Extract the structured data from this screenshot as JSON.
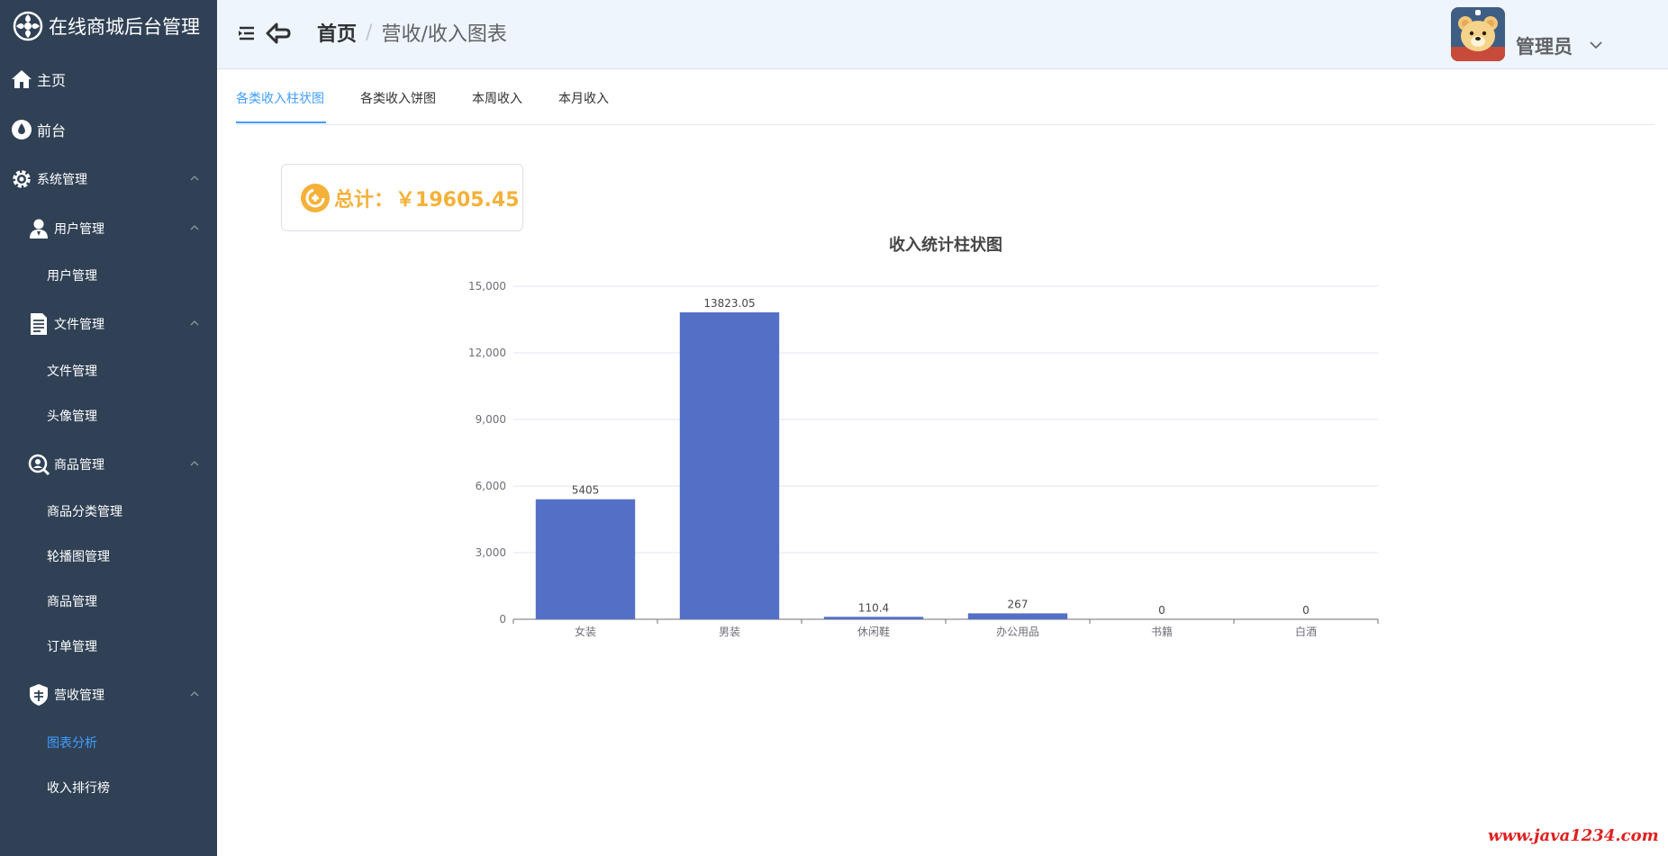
{
  "sidebar": {
    "title": "在线商城后台管理",
    "items": [
      {
        "label": "主页",
        "icon": "home-icon"
      },
      {
        "label": "前台",
        "icon": "drop-icon"
      },
      {
        "label": "系统管理",
        "icon": "gear-icon"
      },
      {
        "label": "用户管理",
        "icon": "user-icon"
      },
      {
        "label": "用户管理"
      },
      {
        "label": "文件管理",
        "icon": "document-icon"
      },
      {
        "label": "文件管理"
      },
      {
        "label": "头像管理"
      },
      {
        "label": "商品管理",
        "icon": "magnifier-icon"
      },
      {
        "label": "商品分类管理"
      },
      {
        "label": "轮播图管理"
      },
      {
        "label": "商品管理"
      },
      {
        "label": "订单管理"
      },
      {
        "label": "营收管理",
        "icon": "shield-icon"
      },
      {
        "label": "图表分析"
      },
      {
        "label": "收入排行榜"
      }
    ],
    "active_color": "#409eff",
    "bg_color": "#304156"
  },
  "header": {
    "breadcrumb_home": "首页",
    "breadcrumb_sep": "/",
    "breadcrumb_current": "营收/收入图表",
    "username": "管理员"
  },
  "tabs": [
    {
      "label": "各类收入柱状图",
      "active": true
    },
    {
      "label": "各类收入饼图",
      "active": false
    },
    {
      "label": "本周收入",
      "active": false
    },
    {
      "label": "本月收入",
      "active": false
    }
  ],
  "summary": {
    "label": "总计：",
    "value": "￥19605.45",
    "color": "#f4b13a"
  },
  "chart_data": {
    "type": "bar",
    "title": "收入统计柱状图",
    "categories": [
      "女装",
      "男装",
      "休闲鞋",
      "办公用品",
      "书籍",
      "白酒"
    ],
    "values": [
      5405,
      13823.05,
      110.4,
      267,
      0,
      0
    ],
    "data_labels": [
      "5405",
      "13823.05",
      "110.4",
      "267",
      "0",
      "0"
    ],
    "yticks": [
      "0",
      "3,000",
      "6,000",
      "9,000",
      "12,000",
      "15,000"
    ],
    "ylim": [
      0,
      15000
    ],
    "bar_color": "#5470c6",
    "grid": true
  },
  "watermark": "www.java1234.com"
}
